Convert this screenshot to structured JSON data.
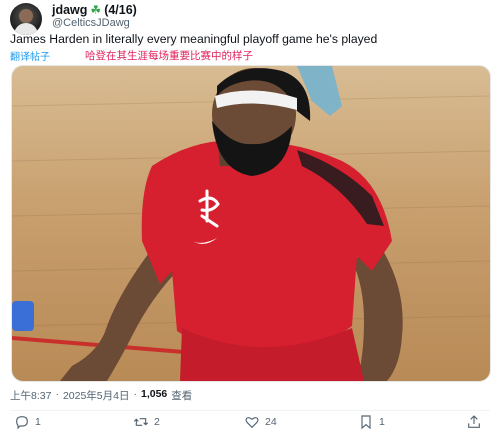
{
  "author": {
    "display_name": "jdawg",
    "badge_icon": "four-leaf-clover-icon",
    "suffix": "(4/16)",
    "handle": "@CelticsJDawg"
  },
  "tweet": {
    "text": "James Harden in literally every meaningful playoff game he's played",
    "translate_label": "翻译帖子",
    "translation": "哈登在其生涯每场重要比赛中的样子"
  },
  "meta": {
    "time": "上午8:37",
    "separator": "·",
    "date": "2025年5月4日",
    "views_count": "1,056",
    "views_label": "查看"
  },
  "actions": {
    "reply": {
      "icon": "reply-icon",
      "count": "1"
    },
    "retweet": {
      "icon": "retweet-icon",
      "count": "2"
    },
    "like": {
      "icon": "heart-icon",
      "count": "24"
    },
    "bookmark": {
      "icon": "bookmark-icon",
      "count": "1"
    },
    "share": {
      "icon": "share-icon"
    }
  },
  "colors": {
    "link_blue": "#1d9bf0",
    "translation_red": "#e0245e",
    "muted_gray": "#536471",
    "jersey_red": "#d7202f"
  }
}
